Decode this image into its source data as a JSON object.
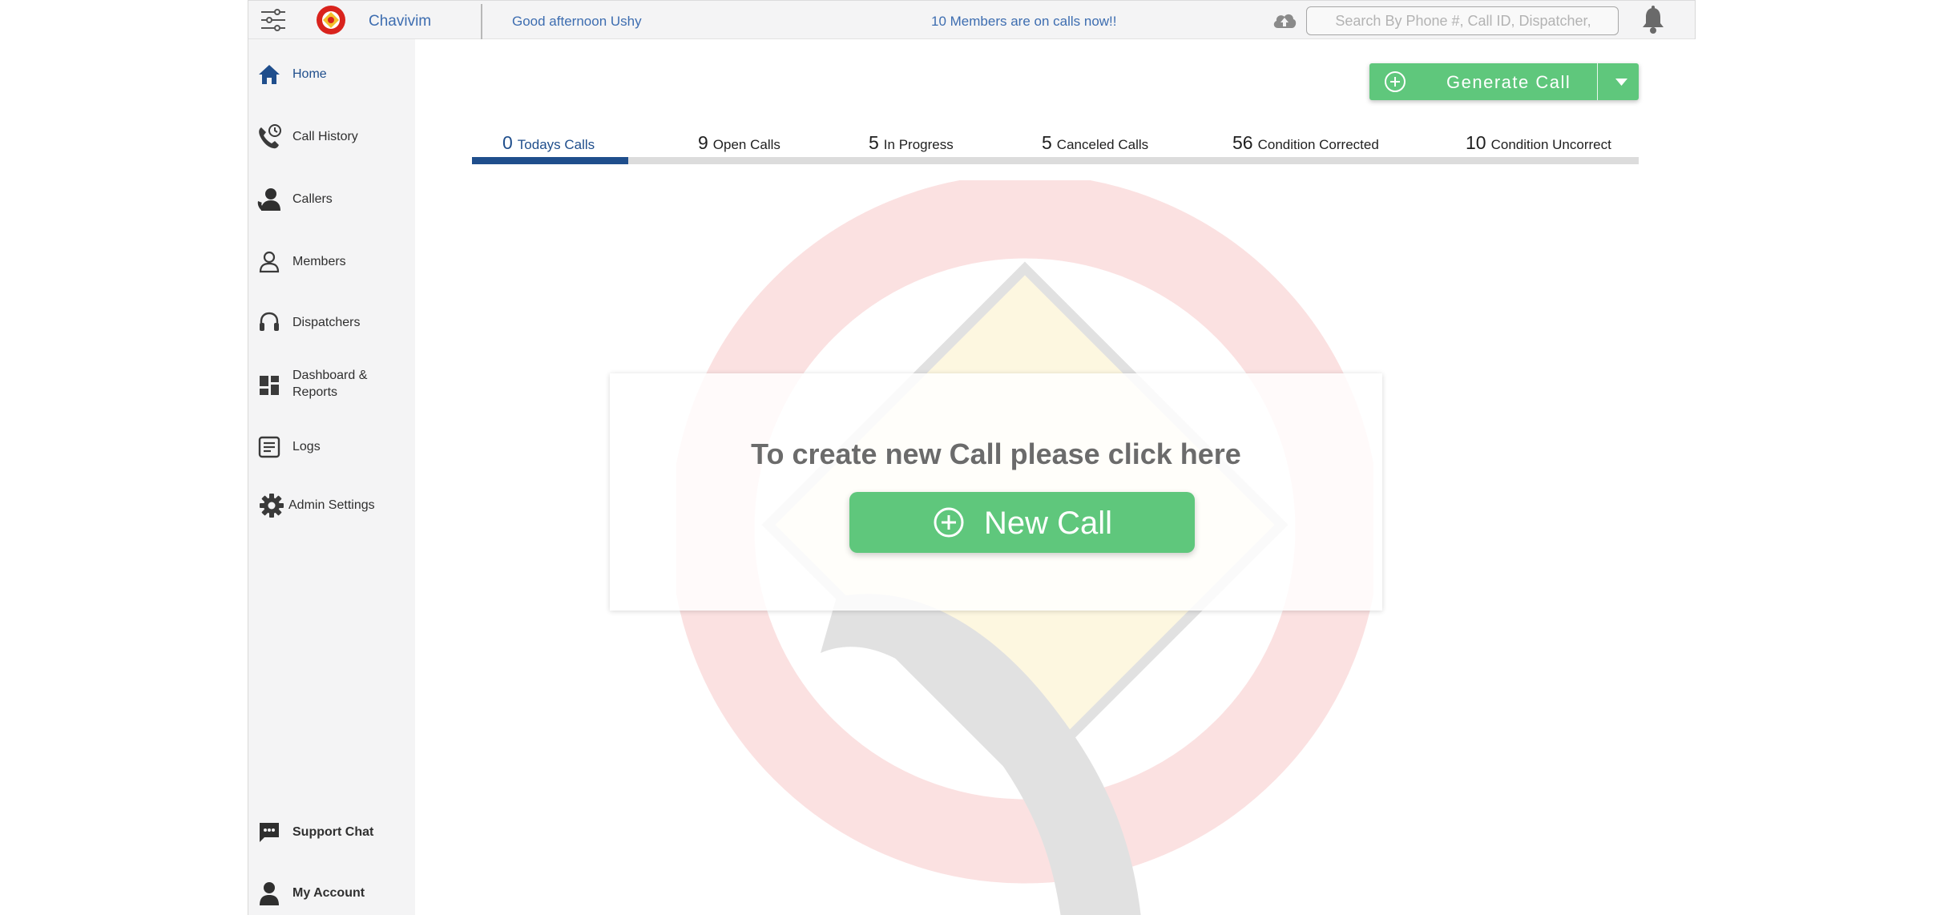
{
  "app": {
    "name": "Chavivim",
    "greeting": "Good afternoon Ushy",
    "members_status": "10 Members are on calls now!!"
  },
  "search": {
    "placeholder": "Search By Phone #, Call ID, Dispatcher,"
  },
  "sidebar": {
    "items": [
      {
        "label": "Home",
        "icon": "home-icon"
      },
      {
        "label": "Call History",
        "icon": "call-history-icon"
      },
      {
        "label": "Callers",
        "icon": "callers-icon"
      },
      {
        "label": "Members",
        "icon": "person-icon"
      },
      {
        "label": "Dispatchers",
        "icon": "headset-icon"
      },
      {
        "label": "Dashboard &",
        "label2": "Reports",
        "icon": "dashboard-icon"
      },
      {
        "label": "Logs",
        "icon": "logs-icon"
      },
      {
        "label": "Admin Settings",
        "icon": "gear-icon"
      }
    ],
    "bottom": [
      {
        "label": "Support Chat",
        "icon": "chat-icon"
      },
      {
        "label": "My Account",
        "icon": "account-icon"
      }
    ]
  },
  "toolbar": {
    "generate_label": "Generate Call"
  },
  "tabs": [
    {
      "count": "0",
      "label": "Todays Calls"
    },
    {
      "count": "9",
      "label": "Open Calls"
    },
    {
      "count": "5",
      "label": "In Progress"
    },
    {
      "count": "5",
      "label": "Canceled Calls"
    },
    {
      "count": "56",
      "label": "Condition Corrected"
    },
    {
      "count": "10",
      "label": "Condition Uncorrect"
    }
  ],
  "card": {
    "prompt": "To create new Call please click here",
    "button_label": "New Call"
  },
  "colors": {
    "accent_blue": "#1f4e8c",
    "link_blue": "#3d6db0",
    "green": "#5fc77c",
    "sidebar_bg": "#f4f4f5"
  }
}
